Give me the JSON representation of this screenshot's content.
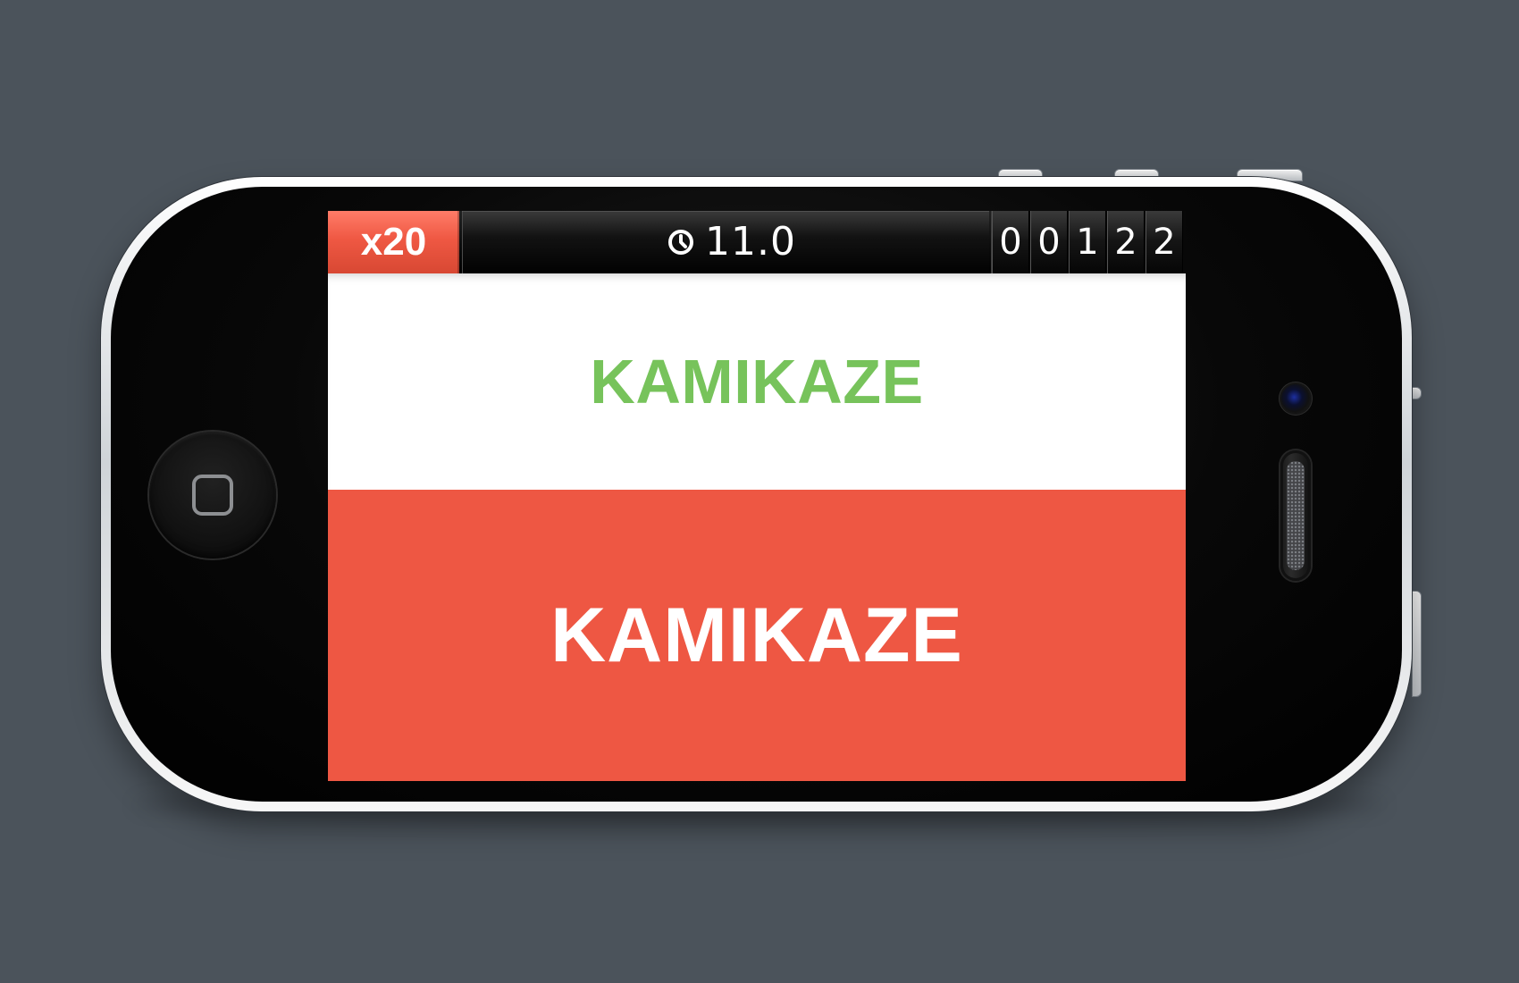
{
  "hud": {
    "multiplier": "x20",
    "timer": "11.0",
    "score_digits": [
      "0",
      "0",
      "1",
      "2",
      "2"
    ]
  },
  "prompt": {
    "word": "KAMIKAZE"
  },
  "answer": {
    "word": "KAMIKAZE"
  },
  "colors": {
    "background": "#4b535b",
    "accent_red": "#ee5743",
    "prompt_green": "#77c35b",
    "hud_black": "#000000"
  },
  "icons": {
    "timer": "clock-icon",
    "home": "home-button-square-icon"
  }
}
